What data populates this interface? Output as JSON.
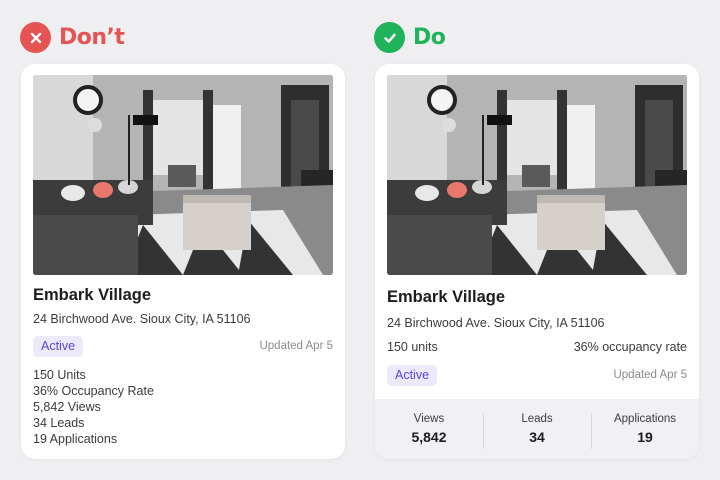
{
  "colors": {
    "dont_accent": "#e65353",
    "do_accent": "#1fb35a",
    "badge_bg": "#ece9fb",
    "badge_text": "#5b45d6"
  },
  "dont": {
    "label": "Don’t",
    "icon": "close-icon",
    "card": {
      "image": "living-room-photo",
      "title": "Embark Village",
      "address": "24 Birchwood Ave. Sioux City, IA 51106",
      "status": "Active",
      "updated": "Updated Apr 5",
      "stats": [
        "150 Units",
        "36% Occupancy Rate",
        "5,842 Views",
        "34 Leads",
        "19 Applications"
      ]
    }
  },
  "do": {
    "label": "Do",
    "icon": "check-icon",
    "card": {
      "image": "living-room-photo",
      "title": "Embark Village",
      "address": "24 Birchwood Ave. Sioux City, IA 51106",
      "units": "150 units",
      "occupancy": "36% occupancy rate",
      "status": "Active",
      "updated": "Updated Apr 5",
      "metrics": [
        {
          "label": "Views",
          "value": "5,842"
        },
        {
          "label": "Leads",
          "value": "34"
        },
        {
          "label": "Applications",
          "value": "19"
        }
      ]
    }
  }
}
